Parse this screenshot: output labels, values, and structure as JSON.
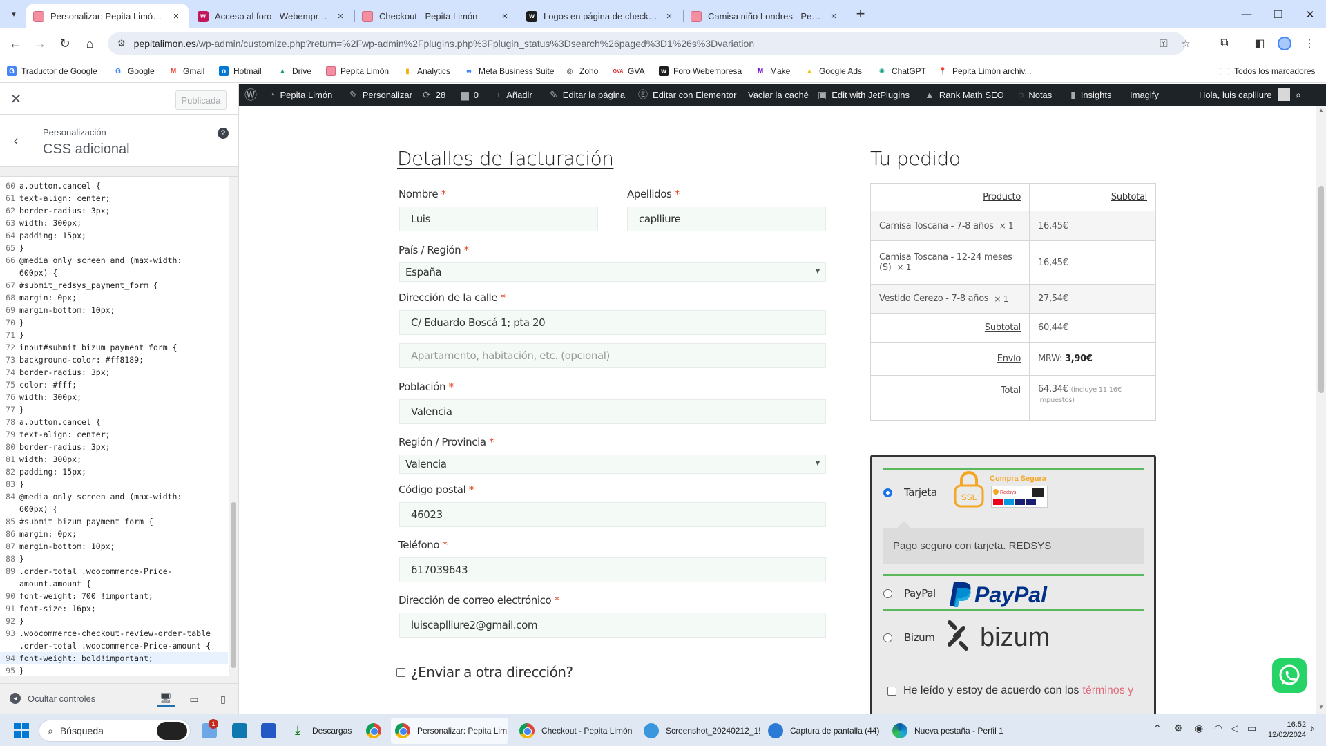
{
  "browser": {
    "tabs": [
      {
        "title": "Personalizar: Pepita Limón – Bra",
        "icon": "pepita-limon-icon",
        "active": true
      },
      {
        "title": "Acceso al foro - Webempresa E",
        "icon": "webempresa-icon",
        "active": false
      },
      {
        "title": "Checkout - Pepita Limón",
        "icon": "pepita-limon-icon",
        "active": false
      },
      {
        "title": "Logos en página de checkout -",
        "icon": "webempresa-forum-icon",
        "active": false
      },
      {
        "title": "Camisa niño Londres - Pepita L",
        "icon": "pepita-limon-icon",
        "active": false
      }
    ],
    "url_host": "pepitalimon.es",
    "url_path": "/wp-admin/customize.php?return=%2Fwp-admin%2Fplugins.php%3Fplugin_status%3Dsearch%26paged%3D1%26s%3Dvariation",
    "bookmarks": [
      {
        "label": "Traductor de Google",
        "icon": "google-translate-icon",
        "color": "#4285f4"
      },
      {
        "label": "Google",
        "icon": "google-icon",
        "color": "#4285f4"
      },
      {
        "label": "Gmail",
        "icon": "gmail-icon",
        "color": "#ea4335"
      },
      {
        "label": "Hotmail",
        "icon": "outlook-icon",
        "color": "#0078d4"
      },
      {
        "label": "Drive",
        "icon": "drive-icon",
        "color": "#0f9d58"
      },
      {
        "label": "Pepita Limón",
        "icon": "pepita-limon-icon",
        "color": "#f48fa2"
      },
      {
        "label": "Analytics",
        "icon": "analytics-icon",
        "color": "#f9ab00"
      },
      {
        "label": "Meta Business Suite",
        "icon": "meta-icon",
        "color": "#0866ff"
      },
      {
        "label": "Zoho",
        "icon": "zoho-icon",
        "color": "#333333"
      },
      {
        "label": "GVA",
        "icon": "gva-icon",
        "color": "#d32f2f"
      },
      {
        "label": "Foro Webempresa",
        "icon": "webempresa-forum-icon",
        "color": "#1d1d1d"
      },
      {
        "label": "Make",
        "icon": "make-icon",
        "color": "#6d00cc"
      },
      {
        "label": "Google Ads",
        "icon": "google-ads-icon",
        "color": "#fbbc04"
      },
      {
        "label": "ChatGPT",
        "icon": "chatgpt-icon",
        "color": "#10a37f"
      },
      {
        "label": "Pepita Limón archiv...",
        "icon": "location-pin-icon",
        "color": "#777777"
      }
    ],
    "all_bookmarks": "Todos los marcadores"
  },
  "customizer": {
    "publish_label": "Publicada",
    "breadcrumb": "Personalización",
    "section_title": "CSS adicional",
    "hide_controls": "Ocultar controles",
    "code_lines": [
      {
        "n": "60",
        "t": "a.button.cancel {"
      },
      {
        "n": "61",
        "t": "text-align: center;"
      },
      {
        "n": "62",
        "t": "border-radius: 3px;"
      },
      {
        "n": "63",
        "t": "width: 300px;"
      },
      {
        "n": "64",
        "t": "padding: 15px;"
      },
      {
        "n": "65",
        "t": "}"
      },
      {
        "n": "66",
        "t": "@media only screen and (max-width:"
      },
      {
        "n": "",
        "t": "600px) {"
      },
      {
        "n": "67",
        "t": "#submit_redsys_payment_form {"
      },
      {
        "n": "68",
        "t": "margin: 0px;"
      },
      {
        "n": "69",
        "t": "margin-bottom: 10px;"
      },
      {
        "n": "70",
        "t": "}"
      },
      {
        "n": "71",
        "t": "}"
      },
      {
        "n": "72",
        "t": "input#submit_bizum_payment_form {"
      },
      {
        "n": "73",
        "t": "background-color: #ff8189;"
      },
      {
        "n": "74",
        "t": "border-radius: 3px;"
      },
      {
        "n": "75",
        "t": "color: #fff;"
      },
      {
        "n": "76",
        "t": "width: 300px;"
      },
      {
        "n": "77",
        "t": "}"
      },
      {
        "n": "78",
        "t": "a.button.cancel {"
      },
      {
        "n": "79",
        "t": "text-align: center;"
      },
      {
        "n": "80",
        "t": "border-radius: 3px;"
      },
      {
        "n": "81",
        "t": "width: 300px;"
      },
      {
        "n": "82",
        "t": "padding: 15px;"
      },
      {
        "n": "83",
        "t": "}"
      },
      {
        "n": "84",
        "t": "@media only screen and (max-width:"
      },
      {
        "n": "",
        "t": "600px) {"
      },
      {
        "n": "85",
        "t": "#submit_bizum_payment_form {"
      },
      {
        "n": "86",
        "t": "margin: 0px;"
      },
      {
        "n": "87",
        "t": "margin-bottom: 10px;"
      },
      {
        "n": "88",
        "t": "}"
      },
      {
        "n": "89",
        "t": ".order-total .woocommerce-Price-"
      },
      {
        "n": "",
        "t": "amount.amount {"
      },
      {
        "n": "90",
        "t": "font-weight: 700 !important;"
      },
      {
        "n": "91",
        "t": "font-size: 16px;"
      },
      {
        "n": "92",
        "t": "}"
      },
      {
        "n": "93",
        "t": ".woocommerce-checkout-review-order-table"
      },
      {
        "n": "",
        "t": ".order-total .woocommerce-Price-amount {"
      },
      {
        "n": "94",
        "t": "font-weight: bold!important;"
      },
      {
        "n": "95",
        "t": "}"
      }
    ]
  },
  "adminbar": {
    "site": "Pepita Limón",
    "customize": "Personalizar",
    "updates": "28",
    "comments": "0",
    "add_new": "Añadir",
    "edit_page": "Editar la página",
    "elementor": "Editar con Elementor",
    "clear_cache": "Vaciar la caché",
    "jetplugins": "Edit with JetPlugins",
    "rankmath": "Rank Math SEO",
    "notes": "Notas",
    "insights": "Insights",
    "imagify": "Imagify",
    "greeting": "Hola, luis caplliure"
  },
  "checkout": {
    "billing_title": "Detalles de facturación",
    "required_mark": "*",
    "first_name_label": "Nombre",
    "first_name": "Luis",
    "last_name_label": "Apellidos",
    "last_name": "caplliure",
    "country_label": "País / Región",
    "country": "España",
    "address_label": "Dirección de la calle",
    "address_1": "C/ Eduardo Boscá 1; pta 20",
    "address_2_placeholder": "Apartamento, habitación, etc. (opcional)",
    "city_label": "Población",
    "city": "Valencia",
    "state_label": "Región / Provincia",
    "state": "Valencia",
    "postcode_label": "Código postal",
    "postcode": "46023",
    "phone_label": "Teléfono",
    "phone": "617039643",
    "email_label": "Dirección de correo electrónico",
    "email": "luiscaplliure2@gmail.com",
    "ship_different": "¿Enviar a otra dirección?"
  },
  "order": {
    "title": "Tu pedido",
    "col_product": "Producto",
    "col_subtotal": "Subtotal",
    "items": [
      {
        "name": "Camisa Toscana - 7-8 años",
        "qty": "× 1",
        "price": "16,45€"
      },
      {
        "name": "Camisa Toscana - 12-24 meses (S)",
        "qty": "× 1",
        "price": "16,45€"
      },
      {
        "name": "Vestido Cerezo - 7-8 años",
        "qty": "× 1",
        "price": "27,54€"
      }
    ],
    "subtotal_label": "Subtotal",
    "subtotal": "60,44€",
    "shipping_label": "Envío",
    "shipping_method": "MRW:",
    "shipping_cost": "3,90€",
    "total_label": "Total",
    "total": "64,34€",
    "tax_note": "(incluye 11,16€ impuestos)"
  },
  "payment": {
    "card_label": "Tarjeta",
    "ssl_text": "SSL",
    "secure_text": "Compra Segura",
    "redsys_logo": "Redsys",
    "card_desc": "Pago seguro con tarjeta. REDSYS",
    "paypal_label": "PayPal",
    "paypal_logo": "PayPal",
    "bizum_label": "Bizum",
    "bizum_logo": "bizum",
    "terms_text": "He leído y estoy de acuerdo con los",
    "terms_link": "términos y"
  },
  "taskbar": {
    "search": "Búsqueda",
    "notification_count": "1",
    "apps": [
      {
        "label": "Descargas",
        "icon": "downloads-icon"
      },
      {
        "label": "",
        "icon": "chrome-icon"
      },
      {
        "label": "Personalizar: Pepita Lim",
        "icon": "chrome-icon"
      },
      {
        "label": "Checkout - Pepita Limón",
        "icon": "chrome-icon"
      },
      {
        "label": "Screenshot_20240212_1!",
        "icon": "screenshot-app-icon"
      },
      {
        "label": "Captura de pantalla (44)",
        "icon": "photos-icon"
      },
      {
        "label": "Nueva pestaña - Perfil 1",
        "icon": "edge-icon"
      }
    ],
    "time": "16:52",
    "date": "12/02/2024"
  }
}
